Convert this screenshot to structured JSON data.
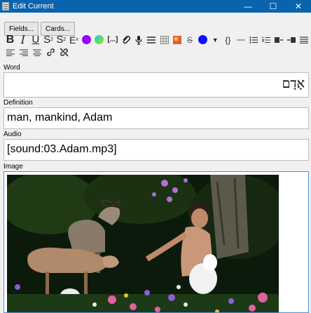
{
  "window": {
    "title": "Edit Current",
    "icon": "app-icon",
    "minimize_glyph": "—",
    "maximize_glyph": "☐",
    "close_glyph": "✕"
  },
  "buttons": {
    "fields": "Fields...",
    "cards": "Cards..."
  },
  "toolbar": {
    "bold": "B",
    "italic": "I",
    "underline": "U",
    "superscript": "S",
    "subscript": "S",
    "clear_format": "E",
    "cloze": "[...]",
    "braces": "{}",
    "text_color": "#9900ff",
    "highlight_color": "#00c0ff",
    "icons_row1": [
      "bold-icon",
      "italic-icon",
      "underline-icon",
      "superscript-icon",
      "subscript-icon",
      "clear-format-icon",
      "text-color-icon",
      "highlight-color-icon",
      "cloze-icon",
      "attach-icon",
      "record-audio-icon",
      "text-align-icon",
      "table-icon",
      "image-occlusion-icon",
      "strikethrough-icon",
      "color-dot-icon",
      "dropdown-icon",
      "mathjax-icon",
      "horizontal-rule-icon",
      "bulleted-list-icon",
      "numbered-list-icon",
      "indent-icon",
      "outdent-icon",
      "justify-icon"
    ],
    "icons_row2": [
      "align-left-icon",
      "align-right-icon",
      "align-center-icon",
      "link-icon",
      "unlink-icon"
    ]
  },
  "fields": [
    {
      "label": "Word",
      "value": "אָדָם"
    },
    {
      "label": "Definition",
      "value": "man, mankind, Adam"
    },
    {
      "label": "Audio",
      "value": "[sound:03.Adam.mp3]"
    },
    {
      "label": "Image",
      "value": ""
    }
  ]
}
